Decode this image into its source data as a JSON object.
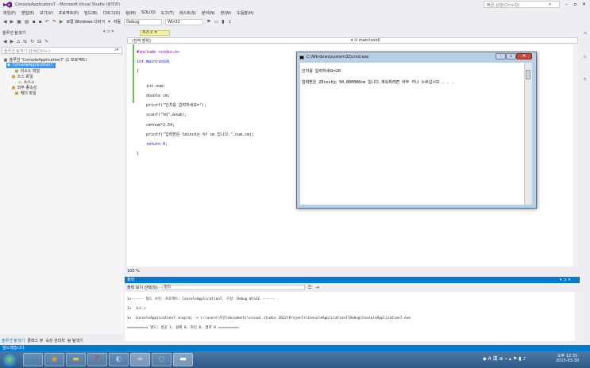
{
  "window": {
    "title": "ConsoleApplication7 - Microsoft Visual Studio (관리자)"
  },
  "quick_launch": {
    "placeholder": "빠른 실행(Ctrl+Q)"
  },
  "menus": [
    "파일(F)",
    "편집(E)",
    "보기(V)",
    "프로젝트(P)",
    "빌드(B)",
    "디버그(D)",
    "팀(M)",
    "SQL(Q)",
    "도구(T)",
    "테스트(S)",
    "분석(N)",
    "창(W)",
    "도움말(H)"
  ],
  "toolbar": {
    "debugger_label": "로컬 Windows 디버거",
    "auto_label": "자동",
    "config": "Debug",
    "platform": "Win32"
  },
  "solution_explorer": {
    "title": "솔루션 탐색기",
    "search_placeholder": "솔루션 탐색기 검색(Ctrl+;)",
    "items": [
      {
        "label": "솔루션 'ConsoleApplication7' (1 프로젝트)",
        "icon": "solution-icon"
      },
      {
        "label": "ConsoleApplication7",
        "icon": "project-icon"
      },
      {
        "label": "리소스 파일",
        "icon": "folder-icon"
      },
      {
        "label": "소스 파일",
        "icon": "folder-icon"
      },
      {
        "label": "소스.c",
        "icon": "c-file-icon"
      },
      {
        "label": "외부 종속성",
        "icon": "folder-icon"
      },
      {
        "label": "헤더 파일",
        "icon": "folder-icon"
      }
    ],
    "bottom_tabs": [
      "솔루션 탐색기",
      "클래스 뷰",
      "속성 관리자",
      "팀 탐색기"
    ]
  },
  "editor": {
    "tab": "소스.c",
    "scope_left": "(전역 범위)",
    "scope_right": "main(void)",
    "zoom": "100 %",
    "code_lines": [
      "#include <stdio.h>",
      "int main(void)",
      "{",
      "",
      "    int num;",
      "    double cm;",
      "    printf(\"인치를 입력하세요=\");",
      "    scanf(\"%d\",&num);",
      "    cm=num*2.54;",
      "    printf(\"입력받은 %dinch는 %f cm 입니다.\",num,cm);",
      "    return 0;",
      "}"
    ]
  },
  "output": {
    "header": "출력",
    "source_label": "출력 보기 선택(S):",
    "source_value": "빌드",
    "lines": [
      "1>------ 빌드 시작: 프로젝트: ConsoleApplication7, 구성: Debug Win32 ------",
      "1>  소스.c",
      "1>  ConsoleApplication7.vcxproj -> c:\\users\\지인\\documents\\visual studio 2012\\Projects\\ConsoleApplication7\\Debug\\ConsoleApplication7.exe",
      "========== 빌드: 성공 1, 실패 0, 최신 0, 생략 0 =========="
    ]
  },
  "status": {
    "text": "빌드했습니다."
  },
  "cmd": {
    "title": "C:\\Windows\\system32\\cmd.exe",
    "lines": [
      "인치를 입력하세요=20",
      "입력받은 20inch는 50.800000cm 입니다.계속하려면 아무 키나 누르십시오 . . ."
    ]
  },
  "clock": {
    "time": "오후 12:35",
    "date": "2015-03-30"
  },
  "tray": {
    "lang": "A 漢"
  },
  "colors": {
    "accent": "#007acc",
    "selection": "#3399ff",
    "taskbar": "#2e5a88"
  }
}
